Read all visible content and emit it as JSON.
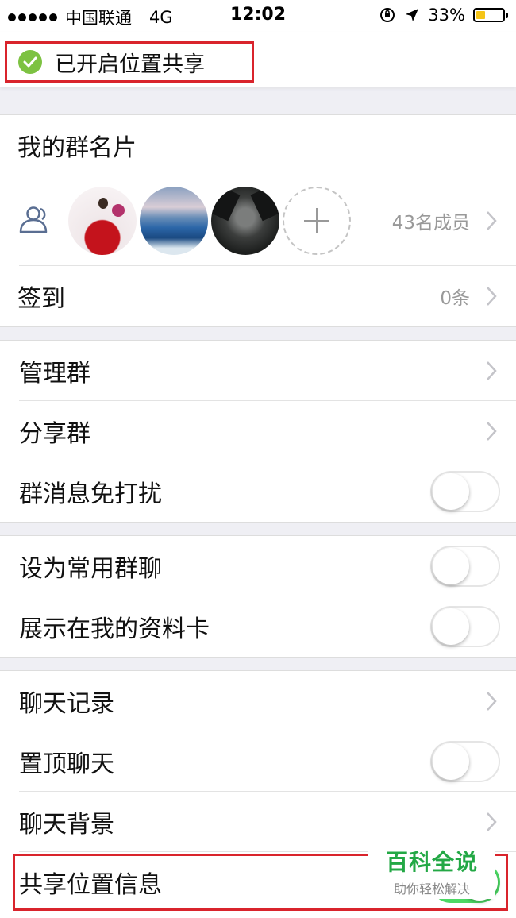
{
  "status_bar": {
    "carrier": "中国联通",
    "network": "4G",
    "time": "12:02",
    "battery": "33%",
    "battery_level": 0.33,
    "battery_color": "#f5c518"
  },
  "banner": {
    "text": "已开启位置共享",
    "icon": "check-circle-icon",
    "icon_color": "#7dc242"
  },
  "group1": {
    "my_card_label": "我的群名片",
    "member_count": "43名成员",
    "checkin_label": "签到",
    "checkin_value": "0条"
  },
  "group2": {
    "manage_label": "管理群",
    "share_label": "分享群",
    "mute_label": "群消息免打扰",
    "mute_on": false
  },
  "group3": {
    "favorite_label": "设为常用群聊",
    "favorite_on": false,
    "show_card_label": "展示在我的资料卡",
    "show_card_on": false
  },
  "group4": {
    "history_label": "聊天记录",
    "pin_label": "置顶聊天",
    "pin_on": false,
    "background_label": "聊天背景",
    "share_location_label": "共享位置信息",
    "share_location_on": true
  },
  "watermark": {
    "title": "百科全说",
    "subtitle": "助你轻松解决"
  },
  "colors": {
    "highlight": "#d9242c",
    "toggle_on": "#4cd964",
    "secondary_text": "#999999"
  }
}
